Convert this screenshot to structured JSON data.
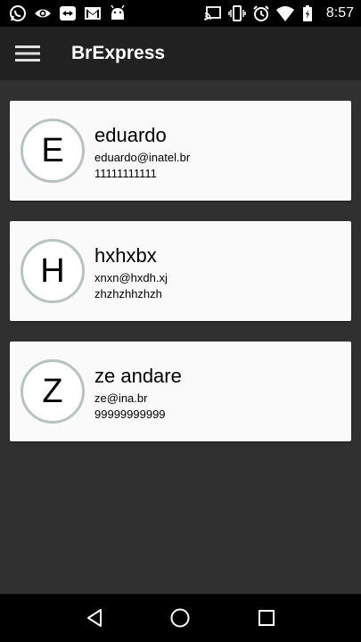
{
  "status_bar": {
    "time": "8:57",
    "left_icons": [
      "whatsapp-icon",
      "eye-icon",
      "teamviewer-icon",
      "gmail-icon",
      "android-icon"
    ],
    "right_icons": [
      "cast-icon",
      "vibrate-icon",
      "alarm-icon",
      "wifi-icon",
      "battery-icon"
    ]
  },
  "app_bar": {
    "title": "BrExpress",
    "menu_icon": "hamburger-menu-icon"
  },
  "contacts": [
    {
      "initial": "E",
      "name": "eduardo",
      "email": "eduardo@inatel.br",
      "phone": "11111111111"
    },
    {
      "initial": "H",
      "name": "hxhxbx",
      "email": "xnxn@hxdh.xj",
      "phone": "zhzhzhhzhzh"
    },
    {
      "initial": "Z",
      "name": "ze andare",
      "email": "ze@ina.br",
      "phone": "99999999999"
    }
  ],
  "nav_bar": {
    "icons": [
      "back-icon",
      "home-icon",
      "recents-icon"
    ]
  },
  "colors": {
    "background": "#303030",
    "app_bar": "#212121",
    "card": "#fafafa",
    "avatar_border": "#b9c2c2"
  }
}
